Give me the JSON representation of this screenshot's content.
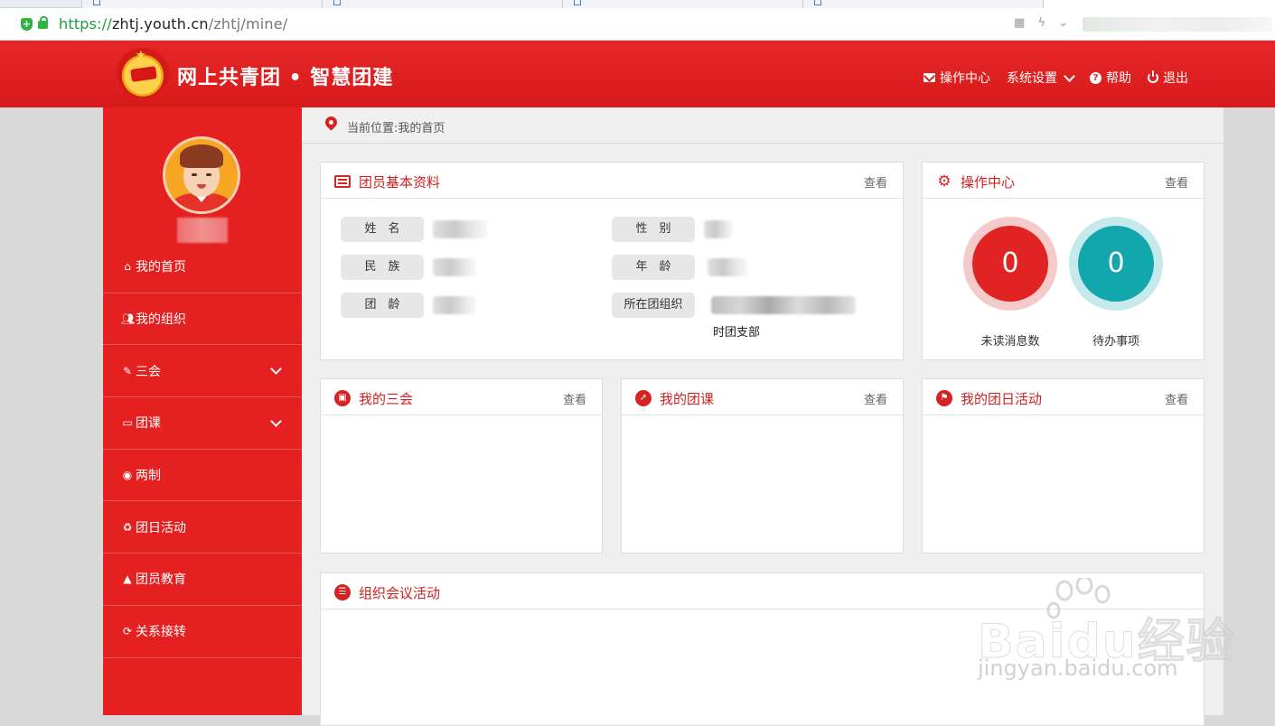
{
  "browser": {
    "url_scheme": "https://",
    "url_host": "zhtj.youth.cn",
    "url_path": "/zhtj/mine/"
  },
  "header": {
    "title": "网上共青团 • 智慧团建",
    "nav": {
      "ops_center": "操作中心",
      "settings": "系统设置",
      "help": "帮助",
      "logout": "退出"
    }
  },
  "sidebar": {
    "items": [
      {
        "label": "我的首页",
        "icon": "home-icon"
      },
      {
        "label": "我的组织",
        "icon": "users-icon"
      },
      {
        "label": "三会",
        "icon": "edit-icon"
      },
      {
        "label": "团课",
        "icon": "folder-icon"
      },
      {
        "label": "两制",
        "icon": "target-icon"
      },
      {
        "label": "团日活动",
        "icon": "recycle-icon"
      },
      {
        "label": "团员教育",
        "icon": "graduation-cap-icon"
      },
      {
        "label": "关系接转",
        "icon": "refresh-icon"
      }
    ]
  },
  "breadcrumb": "当前位置:我的首页",
  "profile_panel": {
    "title": "团员基本资料",
    "view": "查看",
    "fields": {
      "name": "姓　名",
      "gender": "性　别",
      "ethnicity": "民　族",
      "age": "年　龄",
      "league_age": "团　龄",
      "org": "所在团组织"
    },
    "org_suffix": "时团支部"
  },
  "ops_panel": {
    "title": "操作中心",
    "view": "查看",
    "unread_count": "0",
    "unread_label": "未读消息数",
    "todo_count": "0",
    "todo_label": "待办事项",
    "colors": {
      "unread": "#e02424",
      "todo": "#12a6ad"
    }
  },
  "panels": {
    "sanhui": {
      "title": "我的三会",
      "view": "查看"
    },
    "tuanke": {
      "title": "我的团课",
      "view": "查看"
    },
    "tuanri": {
      "title": "我的团日活动",
      "view": "查看"
    },
    "meetings": {
      "title": "组织会议活动"
    }
  },
  "watermark": {
    "brand": "Baidu经验",
    "domain": "jingyan.baidu.com"
  },
  "colors": {
    "brand_red": "#e42020",
    "header_red": "#dd1f1f"
  }
}
